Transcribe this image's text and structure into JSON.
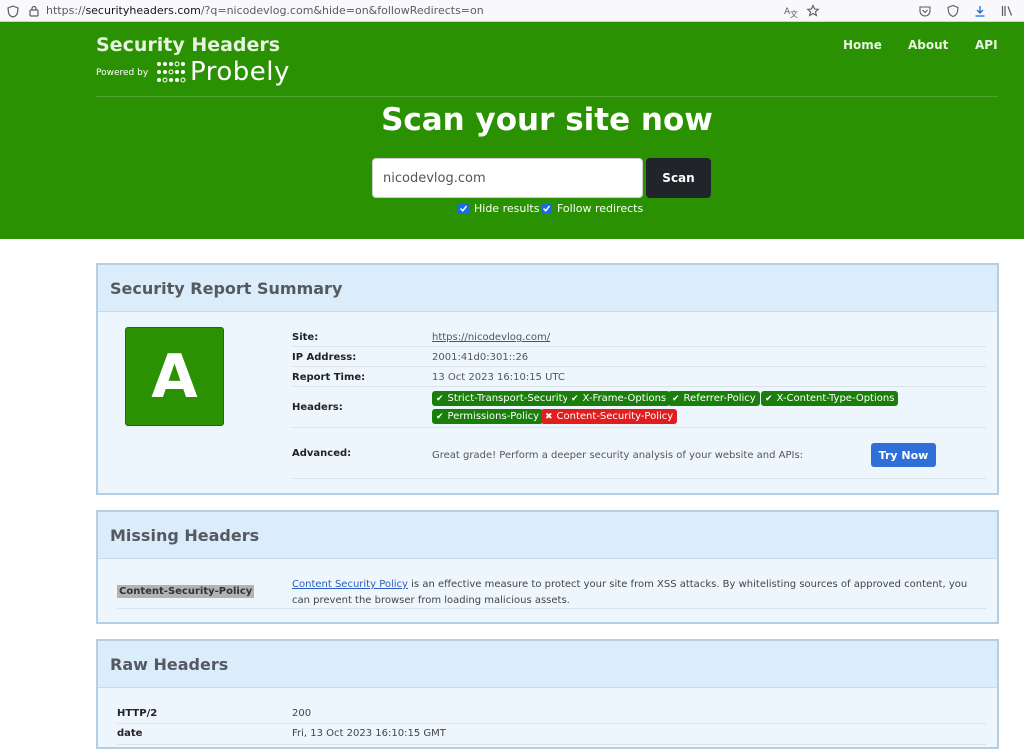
{
  "browser": {
    "url_scheme": "https://",
    "url_host": "securityheaders.com",
    "url_rest": "/?q=nicodevlog.com&hide=on&followRedirects=on",
    "icons": [
      "shield-icon",
      "lock-icon",
      "translate-icon",
      "bookmark-star-icon",
      "pocket-icon",
      "shield-check-icon",
      "download-icon",
      "library-icon"
    ]
  },
  "header": {
    "title": "Security Headers",
    "powered_by": "Powered by",
    "logo_text": "Probely",
    "nav": [
      "Home",
      "About",
      "API"
    ]
  },
  "hero": {
    "headline": "Scan your site now",
    "input_value": "nicodevlog.com",
    "scan_label": "Scan",
    "options": [
      {
        "label": "Hide results",
        "checked": true
      },
      {
        "label": "Follow redirects",
        "checked": true
      }
    ]
  },
  "summary": {
    "title": "Security Report Summary",
    "grade": "A",
    "rows": {
      "site_label": "Site:",
      "site_value": "https://nicodevlog.com/",
      "ip_label": "IP Address:",
      "ip_value": "2001:41d0:301::26",
      "time_label": "Report Time:",
      "time_value": "13 Oct 2023 16:10:15 UTC",
      "headers_label": "Headers:",
      "advanced_label": "Advanced:",
      "advanced_value": "Great grade! Perform a deeper security analysis of your website and APIs:",
      "try_now": "Try Now"
    },
    "headers": [
      {
        "name": "Strict-Transport-Security",
        "status": "present"
      },
      {
        "name": "X-Frame-Options",
        "status": "present"
      },
      {
        "name": "Referrer-Policy",
        "status": "present"
      },
      {
        "name": "X-Content-Type-Options",
        "status": "present"
      },
      {
        "name": "Permissions-Policy",
        "status": "present"
      },
      {
        "name": "Content-Security-Policy",
        "status": "missing"
      }
    ],
    "colors": {
      "present": "#1a7f0a",
      "missing": "#e01e1e",
      "grade": "#2a9202"
    }
  },
  "missing": {
    "title": "Missing Headers",
    "header_name": "Content-Security-Policy",
    "link_text": "Content Security Policy",
    "description": " is an effective measure to protect your site from XSS attacks. By whitelisting sources of approved content, you can prevent the browser from loading malicious assets."
  },
  "raw": {
    "title": "Raw Headers",
    "rows": [
      {
        "key": "HTTP/2",
        "value": "200"
      },
      {
        "key": "date",
        "value": "Fri, 13 Oct 2023 16:10:15 GMT"
      }
    ]
  }
}
